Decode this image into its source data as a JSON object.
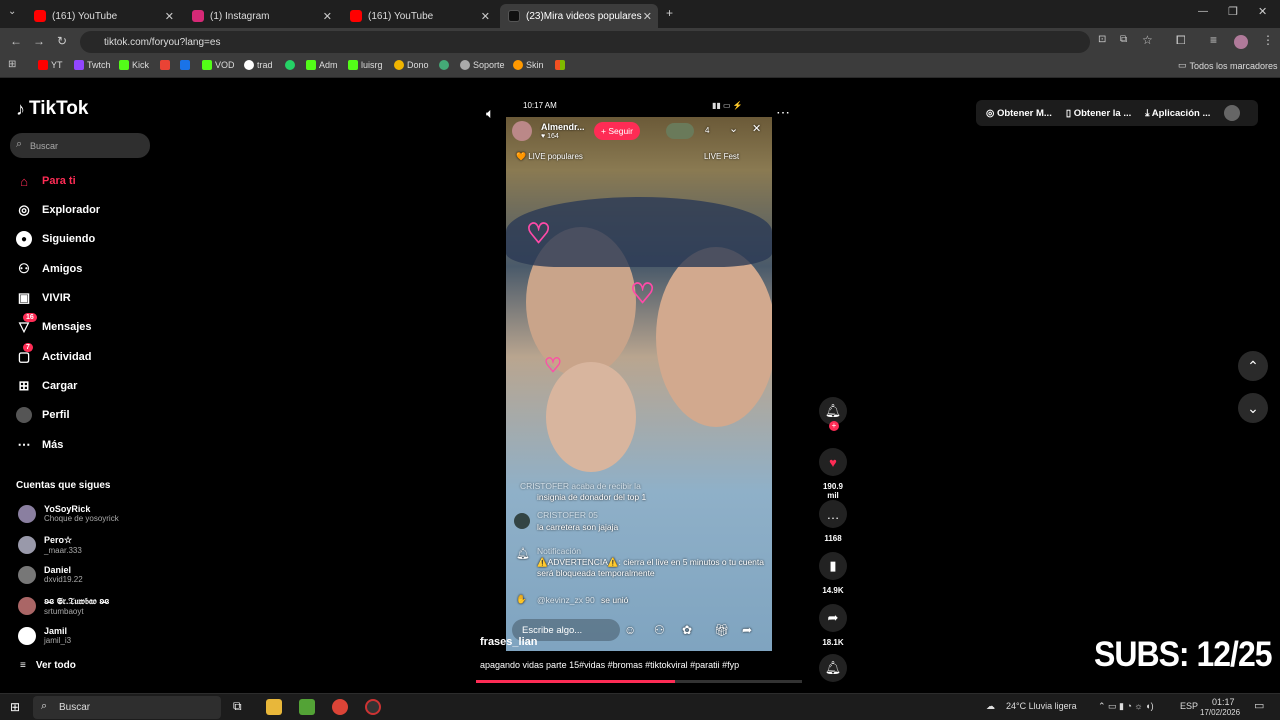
{
  "browser": {
    "tabs": [
      {
        "title": "(161) YouTube",
        "color": "#ff0000"
      },
      {
        "title": "(1) Instagram",
        "color": "#d62976"
      },
      {
        "title": "(161) YouTube",
        "color": "#ff0000"
      },
      {
        "title": "(23)Mira videos populares",
        "color": "#000000"
      }
    ],
    "url": "tiktok.com/foryou?lang=es",
    "bookmarks": [
      "YT",
      "Twtch",
      "Kick",
      "VOD",
      "trad",
      "Adm",
      "luisrg",
      "Dono",
      "Soporte",
      "Skin"
    ],
    "bookmarks_folder": "Todos los marcadores"
  },
  "tiktok": {
    "logo": "TikTok",
    "search_placeholder": "Buscar",
    "nav": [
      {
        "label": "Para ti",
        "icon": "home-icon",
        "active": true
      },
      {
        "label": "Explorador",
        "icon": "compass-icon"
      },
      {
        "label": "Siguiendo",
        "icon": "following-icon"
      },
      {
        "label": "Amigos",
        "icon": "friends-icon"
      },
      {
        "label": "VIVIR",
        "icon": "live-icon"
      },
      {
        "label": "Mensajes",
        "icon": "messages-icon",
        "badge": "16"
      },
      {
        "label": "Actividad",
        "icon": "activity-icon",
        "badge": "7"
      },
      {
        "label": "Cargar",
        "icon": "upload-icon"
      },
      {
        "label": "Perfil",
        "icon": "profile-icon"
      },
      {
        "label": "Más",
        "icon": "more-icon"
      }
    ],
    "following_title": "Cuentas que sigues",
    "following": [
      {
        "name": "YoSoyRick",
        "sub": "Choque de yosoyrick"
      },
      {
        "name": "Pero☆",
        "sub": "_maar.333"
      },
      {
        "name": "Daniel",
        "sub": "dxvid19.22"
      },
      {
        "name": "ʚ̶ɞ 𝕾𝔯.𝔗𝔲𝔴𝔟𝔞𝔬 ʚ̶ɞ",
        "sub": "srtumbaoyt"
      },
      {
        "name": "Jamil",
        "sub": "jamil_i3"
      }
    ],
    "see_all": "Ver todo",
    "video": {
      "status_time": "10:17 AM",
      "host_name": "Almendr...",
      "host_likes": "164",
      "follow_label": "Seguir",
      "viewers": "4",
      "live_tag": "LIVE populares",
      "live_fest": "LIVE Fest",
      "chat": [
        {
          "user": "CRISTOFER",
          "text": "insignia de donador del top 1",
          "pre": "acaba de recibir la"
        },
        {
          "user": "CRISTOFER",
          "text": "la carretera son jajaja",
          "pre": "05"
        },
        {
          "user": "Notificación",
          "text": "⚠️ADVERTENCIA⚠️: cierra el live en 5 minutos o tu cuenta será bloqueada temporalmente",
          "pre": ""
        },
        {
          "user": "@kevinz_zx 90",
          "text": "se unió",
          "pre": ""
        }
      ],
      "comment_placeholder": "Escribe algo...",
      "author": "frases_lian",
      "caption": "apagando vidas parte 15#vidas #bromas #tiktokviral #paratii #fyp"
    },
    "actions": {
      "likes": "190.9 mil",
      "comments": "1168",
      "saves": "14.9K",
      "shares": "18.1K"
    },
    "top_actions": [
      "Obtener M...",
      "Obtener la ...",
      "Aplicación ..."
    ],
    "subs_overlay": "SUBS: 12/25"
  },
  "taskbar": {
    "search": "Buscar",
    "weather": "24°C Lluvia ligera",
    "lang": "ESP",
    "time": "01:17",
    "date": "17/02/2026"
  }
}
